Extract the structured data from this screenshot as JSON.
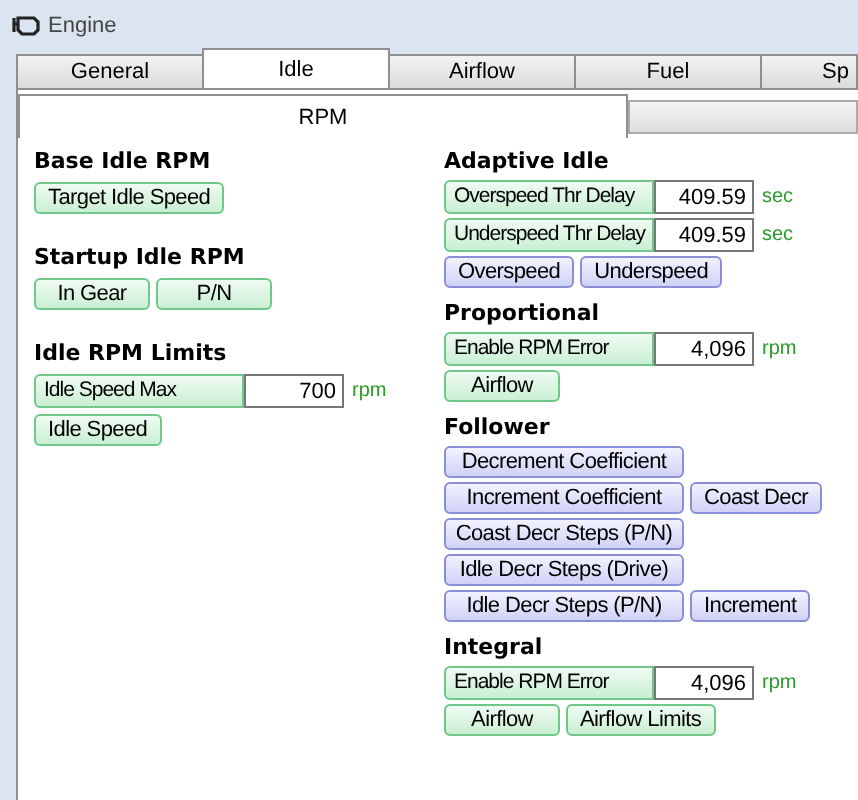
{
  "window": {
    "title": "Engine"
  },
  "tabs": [
    {
      "label": "General",
      "selected": false
    },
    {
      "label": "Idle",
      "selected": true
    },
    {
      "label": "Airflow",
      "selected": false
    },
    {
      "label": "Fuel",
      "selected": false
    },
    {
      "label": "Sp",
      "selected": false
    }
  ],
  "subtabs": [
    {
      "label": "RPM",
      "selected": true
    }
  ],
  "columns": [
    {
      "sections": [
        {
          "title": "Base Idle RPM",
          "rows": [
            [
              {
                "kind": "table",
                "label": "Target Idle Speed"
              }
            ]
          ]
        },
        {
          "title": "Startup Idle RPM",
          "rows": [
            [
              {
                "kind": "table",
                "label": "In Gear"
              },
              {
                "kind": "table",
                "label": "P/N"
              }
            ]
          ]
        },
        {
          "title": "Idle RPM Limits",
          "rows": [
            [
              {
                "kind": "field",
                "label": "Idle Speed Max",
                "value": "700",
                "unit": "rpm"
              }
            ],
            [
              {
                "kind": "table",
                "label": "Idle Speed"
              }
            ]
          ]
        }
      ]
    },
    {
      "sections": [
        {
          "title": "Adaptive Idle",
          "rows": [
            [
              {
                "kind": "field",
                "label": "Overspeed Thr Delay",
                "value": "409.59",
                "unit": "sec"
              }
            ],
            [
              {
                "kind": "field",
                "label": "Underspeed Thr Delay",
                "value": "409.59",
                "unit": "sec"
              }
            ],
            [
              {
                "kind": "curve",
                "label": "Overspeed"
              },
              {
                "kind": "curve",
                "label": "Underspeed"
              }
            ]
          ]
        },
        {
          "title": "Proportional",
          "rows": [
            [
              {
                "kind": "field",
                "label": "Enable RPM Error",
                "value": "4,096",
                "unit": "rpm"
              }
            ],
            [
              {
                "kind": "table",
                "label": "Airflow"
              }
            ]
          ]
        },
        {
          "title": "Follower",
          "rows": [
            [
              {
                "kind": "curve",
                "label": "Decrement Coefficient"
              }
            ],
            [
              {
                "kind": "curve",
                "label": "Increment Coefficient"
              },
              {
                "kind": "curve",
                "label": "Coast Decr"
              }
            ],
            [
              {
                "kind": "curve",
                "label": "Coast Decr Steps (P/N)"
              }
            ],
            [
              {
                "kind": "curve",
                "label": "Idle Decr Steps (Drive)"
              }
            ],
            [
              {
                "kind": "curve",
                "label": "Idle Decr Steps (P/N)"
              },
              {
                "kind": "curve",
                "label": "Increment"
              }
            ]
          ]
        },
        {
          "title": "Integral",
          "rows": [
            [
              {
                "kind": "field",
                "label": "Enable RPM Error",
                "value": "4,096",
                "unit": "rpm"
              }
            ],
            [
              {
                "kind": "table",
                "label": "Airflow"
              },
              {
                "kind": "table",
                "label": "Airflow Limits"
              }
            ]
          ]
        }
      ]
    }
  ]
}
